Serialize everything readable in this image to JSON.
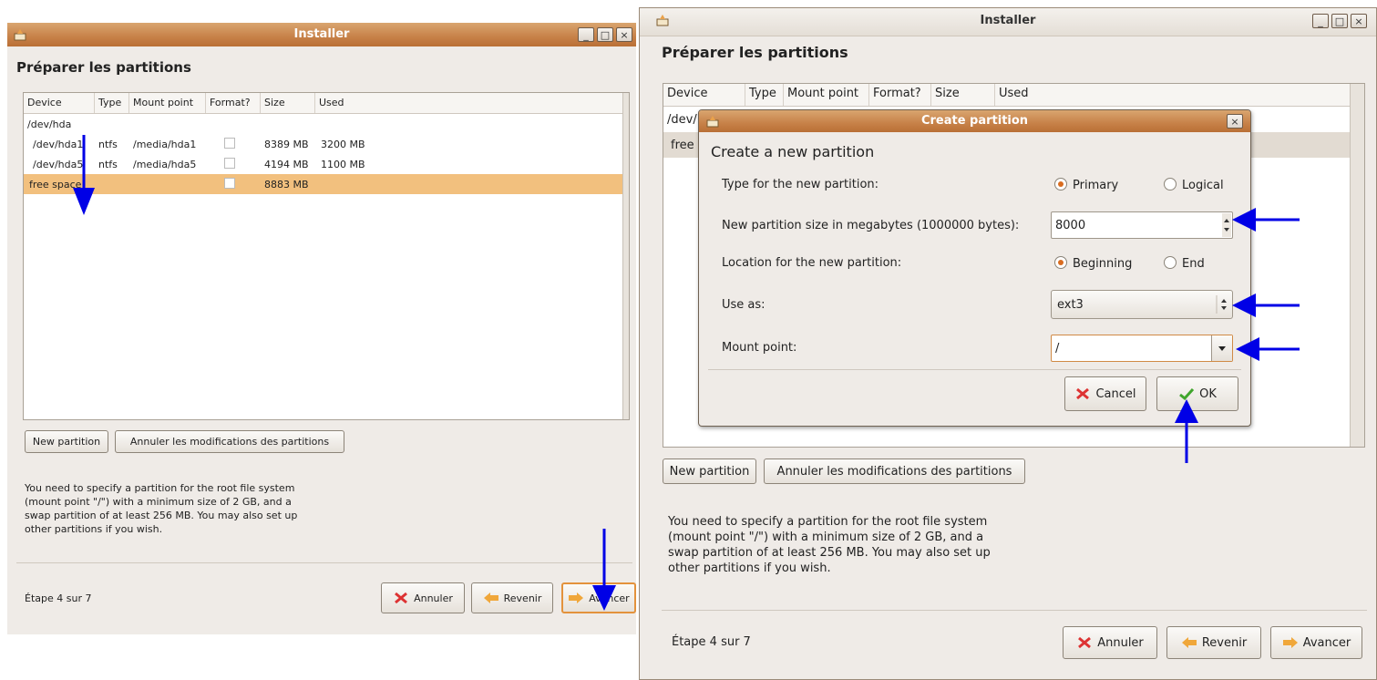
{
  "left_window": {
    "title": "Installer",
    "heading": "Préparer les partitions",
    "columns": [
      "Device",
      "Type",
      "Mount point",
      "Format?",
      "Size",
      "Used"
    ],
    "rows": [
      {
        "device": "/dev/hda",
        "type": "",
        "mount": "",
        "size": "",
        "used": "",
        "format": false
      },
      {
        "device": "/dev/hda1",
        "type": "ntfs",
        "mount": "/media/hda1",
        "size": "8389 MB",
        "used": "3200 MB",
        "format": true
      },
      {
        "device": "/dev/hda5",
        "type": "ntfs",
        "mount": "/media/hda5",
        "size": "4194 MB",
        "used": "1100 MB",
        "format": true
      },
      {
        "device": "free space",
        "type": "",
        "mount": "",
        "size": "8883 MB",
        "used": "",
        "format": true
      }
    ],
    "new_partition": "New partition",
    "undo_changes": "Annuler les modifications des partitions",
    "info": [
      "You need to specify a partition for the root file system",
      "(mount point \"/\") with a minimum size of 2 GB, and a",
      "swap partition of at least 256 MB. You may also set up",
      "other partitions if you wish."
    ],
    "step": "Étape 4 sur 7",
    "cancel": "Annuler",
    "back": "Revenir",
    "forward": "Avancer"
  },
  "right_window": {
    "title": "Installer",
    "heading": "Préparer les partitions",
    "columns": [
      "Device",
      "Type",
      "Mount point",
      "Format?",
      "Size",
      "Used"
    ],
    "row1": "/dev/",
    "row2": "free",
    "new_partition": "New partition",
    "undo_changes": "Annuler les modifications des partitions",
    "info": [
      "You need to specify a partition for the root file system",
      "(mount point \"/\") with a minimum size of 2 GB, and a",
      "swap partition of at least 256 MB. You may also set up",
      "other partitions if you wish."
    ],
    "step": "Étape 4 sur 7",
    "cancel": "Annuler",
    "back": "Revenir",
    "forward": "Avancer"
  },
  "dialog": {
    "title": "Create partition",
    "heading": "Create a new partition",
    "type_label": "Type for the new partition:",
    "type_primary": "Primary",
    "type_logical": "Logical",
    "size_label": "New partition size in megabytes (1000000 bytes):",
    "size_value": "8000",
    "location_label": "Location for the new partition:",
    "location_beginning": "Beginning",
    "location_end": "End",
    "use_as_label": "Use as:",
    "use_as_value": "ext3",
    "mount_label": "Mount point:",
    "mount_value": "/",
    "cancel": "Cancel",
    "ok": "OK"
  },
  "colors": {
    "accent": "#e3923c",
    "selection": "#f2c07e",
    "titlebar": "#c78148",
    "annotation_arrow": "#0000e6"
  }
}
